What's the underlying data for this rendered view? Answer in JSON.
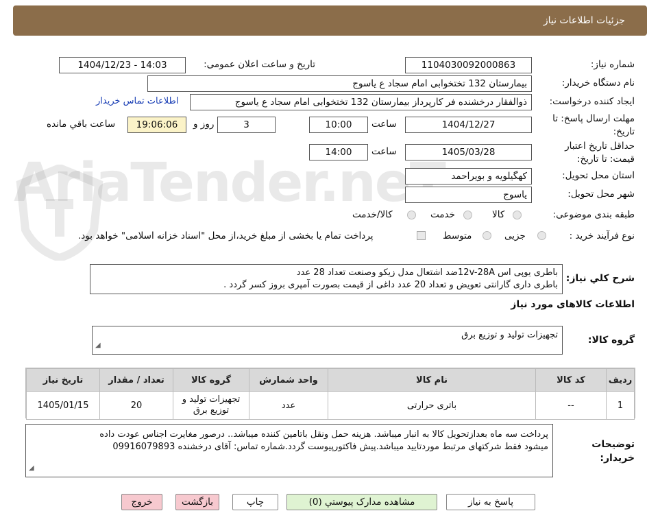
{
  "header": {
    "title": "جزئیات اطلاعات نیاز"
  },
  "watermark": {
    "text": "AriaTender.neT"
  },
  "need": {
    "number_label": "شماره نیاز:",
    "number_value": "1104030092000863",
    "announce_label": "تاریخ و ساعت اعلان عمومی:",
    "announce_value": "1404/12/23 - 14:03",
    "buyer_label": "نام دستگاه خریدار:",
    "buyer_value": "بیمارستان 132 تختخوابی امام سجاد  ع  یاسوج",
    "creator_label": "ایجاد کننده درخواست:",
    "creator_value": "ذوالفقار درخشنده فر کارپرداز بیمارستان 132 تختخوابی امام سجاد  ع  یاسوج",
    "contact_link": "اطلاعات تماس خریدار",
    "deadline_label": "مهلت ارسال پاسخ: تا تاریخ:",
    "deadline_date": "1404/12/27",
    "time_label": "ساعت",
    "deadline_time": "10:00",
    "days_value": "3",
    "days_label": "روز و",
    "remaining_value": "19:06:06",
    "remaining_label": "ساعت باقي مانده",
    "validity_label": "حداقل تاریخ اعتبار قیمت: تا تاریخ:",
    "validity_date": "1405/03/28",
    "validity_time": "14:00",
    "province_label": "استان محل تحویل:",
    "province_value": "کهگیلویه و بویراحمد",
    "city_label": "شهر محل تحویل:",
    "city_value": "یاسوج",
    "category_label": "طبقه بندی موضوعی:",
    "category_options": [
      "کالا",
      "خدمت",
      "کالا/خدمت"
    ],
    "process_label": "نوع فرآیند خرید :",
    "process_options": [
      "جزیی",
      "متوسط"
    ],
    "payment_note": "پرداخت تمام یا بخشی از مبلغ خرید،از محل \"اسناد خزانه اسلامی\" خواهد بود."
  },
  "summary": {
    "label": "شرح کلي نياز:",
    "line1": "باطری یوپی اس 12v-28Aضد اشتعال مدل زیکو وصنعت تعداد 28 عدد",
    "line2": "باطری داری گارانتی تعویض و تعداد 20 عدد داغی از قیمت بصورت آمپری بروز کسر گردد ."
  },
  "goods": {
    "section_title": "اطلاعات کالاهای مورد نیاز",
    "group_label": "گروه کالا:",
    "group_value": "تجهیزات تولید و توزیع برق",
    "columns": [
      "ردیف",
      "کد کالا",
      "نام کالا",
      "واحد شمارش",
      "گروه کالا",
      "تعداد / مقدار",
      "تاریخ نیاز"
    ],
    "rows": [
      {
        "row": "1",
        "code": "--",
        "name": "باتری حرارتی",
        "unit": "عدد",
        "group": "تجهیزات تولید و توزیع برق",
        "qty": "20",
        "date": "1405/01/15"
      }
    ]
  },
  "notes": {
    "label": "توضیحات خریدار:",
    "line1": "پرداخت سه ماه بعدازتحویل کالا به انبار میباشد. هزینه حمل ونقل باتامین کننده میباشد.. درصور مغایرت اجناس عودت داده",
    "line2": "میشود فقط شرکتهای مرتبط موردتایید میباشد.پیش فاکتورپیوست گردد.شماره تماس: آقای درخشنده 09916079893"
  },
  "buttons": {
    "reply": "پاسخ به نیاز",
    "attachments": "مشاهده مدارک پیوستي (0)",
    "print": "چاپ",
    "back": "بازگشت",
    "exit": "خروج"
  }
}
